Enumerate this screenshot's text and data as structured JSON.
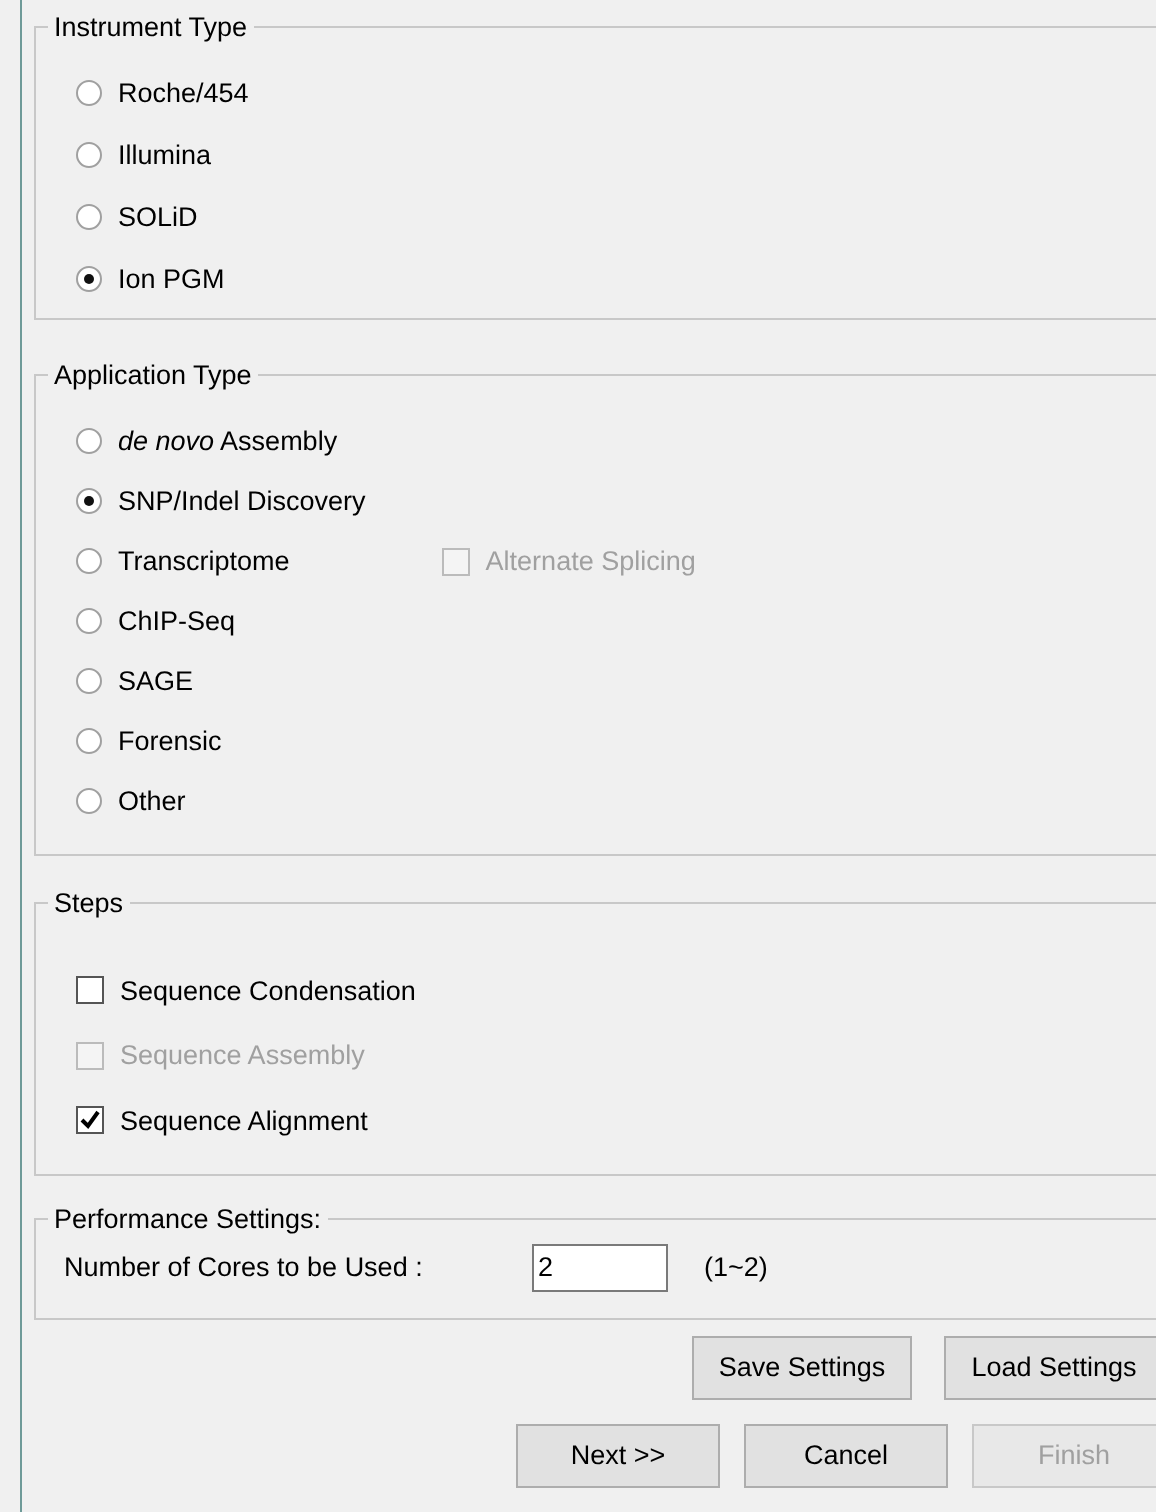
{
  "instrument_type": {
    "title": "Instrument Type",
    "options": [
      {
        "label": "Roche/454",
        "selected": false
      },
      {
        "label": "Illumina",
        "selected": false
      },
      {
        "label": "SOLiD",
        "selected": false
      },
      {
        "label": "Ion PGM",
        "selected": true
      }
    ]
  },
  "application_type": {
    "title": "Application Type",
    "options": [
      {
        "label": "*de novo* Assembly",
        "selected": false
      },
      {
        "label": "SNP/Indel Discovery",
        "selected": true
      },
      {
        "label": "Transcriptome",
        "selected": false
      },
      {
        "label": "ChIP-Seq",
        "selected": false
      },
      {
        "label": "SAGE",
        "selected": false
      },
      {
        "label": "Forensic",
        "selected": false
      },
      {
        "label": "Other",
        "selected": false
      }
    ],
    "alternate_splicing": {
      "label": "Alternate Splicing",
      "checked": false,
      "disabled": true
    }
  },
  "steps": {
    "title": "Steps",
    "items": [
      {
        "label": "Sequence Condensation",
        "checked": false,
        "disabled": false
      },
      {
        "label": "Sequence Assembly",
        "checked": false,
        "disabled": true
      },
      {
        "label": "Sequence Alignment",
        "checked": true,
        "disabled": false
      }
    ]
  },
  "performance": {
    "title": "Performance Settings:",
    "cores_label": "Number of Cores to be Used :",
    "cores_value": "2",
    "cores_range": "(1~2)"
  },
  "settings_buttons": [
    {
      "label": "Save Settings",
      "disabled": false
    },
    {
      "label": "Load Settings",
      "disabled": false
    }
  ],
  "nav_buttons": [
    {
      "label": "Next >>",
      "disabled": false
    },
    {
      "label": "Cancel",
      "disabled": false
    },
    {
      "label": "Finish",
      "disabled": true
    }
  ]
}
